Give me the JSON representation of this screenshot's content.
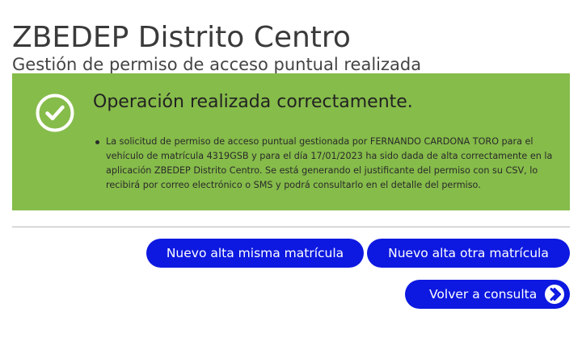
{
  "header": {
    "title": "ZBEDEP Distrito Centro",
    "subtitle": "Gestión de permiso de acceso puntual realizada"
  },
  "alert": {
    "status": "success",
    "background_color": "#86bc4a",
    "icon": "check-circle-icon",
    "heading": "Operación realizada correctamente.",
    "messages": [
      "La solicitud de permiso de acceso puntual gestionada por FERNANDO CARDONA TORO para el vehículo de matrícula 4319GSB y para el día 17/01/2023 ha sido dada de alta correctamente en la aplicación ZBEDEP Distrito Centro. Se está generando el justificante del permiso con su CSV, lo recibirá por correo electrónico o SMS y podrá consultarlo en el detalle del permiso."
    ]
  },
  "actions": {
    "button_color": "#0d19e0",
    "new_same_plate_label": "Nuevo alta misma matrícula",
    "new_other_plate_label": "Nuevo alta otra matrícula",
    "back_to_query_label": "Volver a consulta",
    "back_icon": "chevron-right-circle-icon"
  }
}
